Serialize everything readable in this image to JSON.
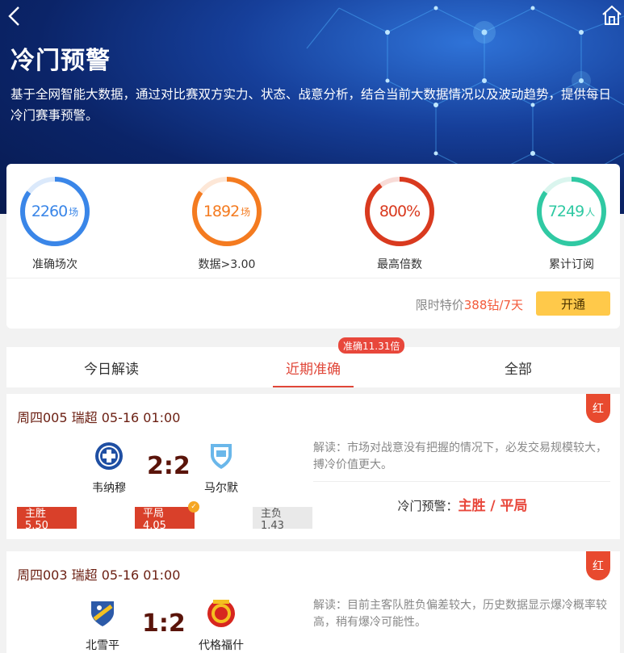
{
  "header": {
    "title": "冷门预警",
    "description": "基于全网智能大数据，通过对比赛双方实力、状态、战意分析，结合当前大数据情况以及波动趋势，提供每日冷门赛事预警。",
    "back_icon": "chevron-left-icon",
    "home_icon": "home-icon"
  },
  "stats": [
    {
      "value": "2260",
      "unit": "场",
      "label": "准确场次",
      "color": "#3a86e8",
      "fill": 0.85
    },
    {
      "value": "1892",
      "unit": "场",
      "label": "数据>3.00",
      "color": "#f47b20",
      "fill": 0.85
    },
    {
      "value": "800%",
      "unit": "",
      "label": "最高倍数",
      "color": "#d93a1f",
      "fill": 0.9
    },
    {
      "value": "7249",
      "unit": "人",
      "label": "累计订阅",
      "color": "#30c9a3",
      "fill": 0.85
    }
  ],
  "subscribe": {
    "price_prefix": "限时特价",
    "price_value": "388钻/7天",
    "button_label": "开通"
  },
  "tabs": {
    "items": [
      "今日解读",
      "近期准确",
      "全部"
    ],
    "active_index": 1,
    "badge": "准确11.31倍"
  },
  "matches": [
    {
      "title": "周四005 瑞超 05-16 01:00",
      "result_flag": "红",
      "home": "韦纳穆",
      "away": "马尔默",
      "score": "2:2",
      "analysis": "解读：市场对战意没有把握的情况下，必发交易规模较大，搏冷价值更大。",
      "warn_label": "冷门预警：",
      "warn_pick": "主胜 / 平局",
      "odds": [
        {
          "label": "主胜5.50",
          "selected": true
        },
        {
          "label": "平局4.05",
          "selected": true,
          "hit": true
        },
        {
          "label": "主负 1.43",
          "selected": false
        }
      ]
    },
    {
      "title": "周四003 瑞超 05-16 01:00",
      "result_flag": "红",
      "home": "北雪平",
      "away": "代格福什",
      "score": "1:2",
      "analysis": "解读：目前主客队胜负偏差较大，历史数据显示爆冷概率较高，稍有爆冷可能性。"
    }
  ]
}
